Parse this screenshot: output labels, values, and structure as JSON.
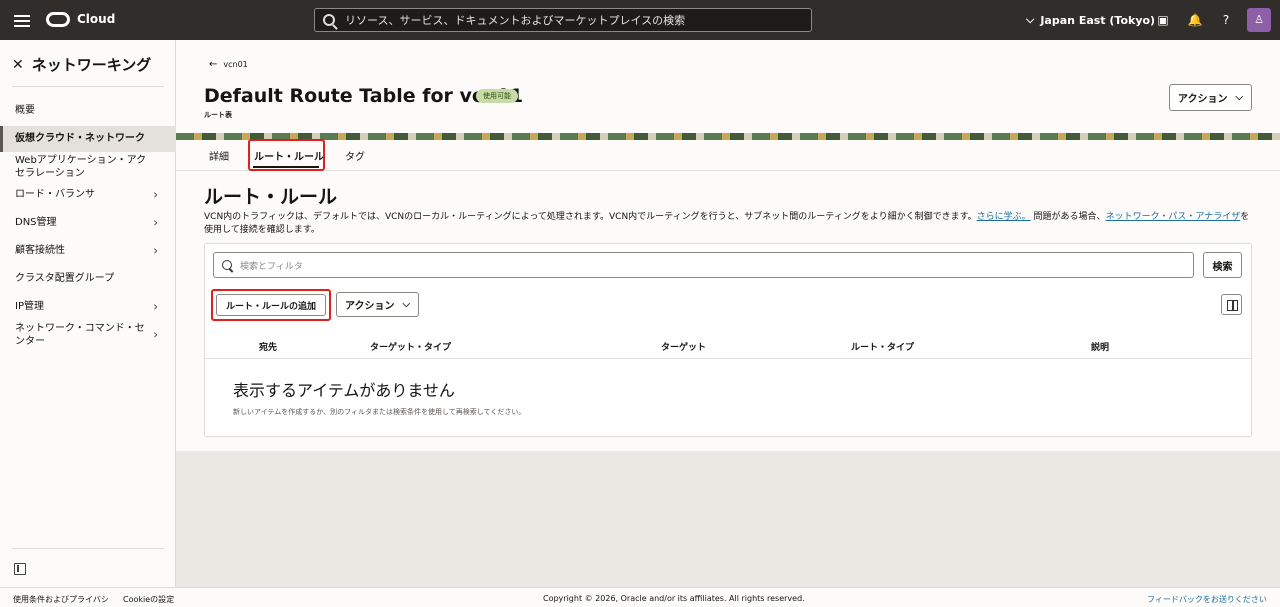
{
  "topbar": {
    "brand": "Cloud",
    "search_placeholder": "リソース、サービス、ドキュメントおよびマーケットプレイスの検索",
    "region": "Japan East (Tokyo)"
  },
  "sidebar": {
    "title": "ネットワーキング",
    "items": [
      {
        "label": "概要"
      },
      {
        "label": "仮想クラウド・ネットワーク"
      },
      {
        "label": "Webアプリケーション・アクセラレーション"
      },
      {
        "label": "ロード・バランサ"
      },
      {
        "label": "DNS管理"
      },
      {
        "label": "顧客接続性"
      },
      {
        "label": "クラスタ配置グループ"
      },
      {
        "label": "IP管理"
      },
      {
        "label": "ネットワーク・コマンド・センター"
      }
    ]
  },
  "header": {
    "back_label": "vcn01",
    "title": "Default Route Table for vcn01",
    "status_badge": "使用可能",
    "subtitle": "ルート表",
    "action_label": "アクション"
  },
  "tabs": [
    {
      "label": "詳細"
    },
    {
      "label": "ルート・ルール"
    },
    {
      "label": "タグ"
    }
  ],
  "section": {
    "title": "ルート・ルール",
    "desc_part1": "VCN内のトラフィックは、デフォルトでは、VCNのローカル・ルーティングによって処理されます。VCN内でルーティングを行うと、サブネット間のルーティングをより細かく制御できます。",
    "link1": "さらに学ぶ。",
    "desc_part2": " 問題がある場合、",
    "link2": "ネットワーク・パス・アナライザ",
    "desc_part3": "を使用して接続を確認します。"
  },
  "toolbar": {
    "filter_placeholder": "検索とフィルタ",
    "search_label": "検索",
    "add_label": "ルート・ルールの追加",
    "action_label": "アクション"
  },
  "table": {
    "columns": [
      "宛先",
      "ターゲット・タイプ",
      "ターゲット",
      "ルート・タイプ",
      "説明"
    ],
    "empty_title": "表示するアイテムがありません",
    "empty_desc": "新しいアイテムを作成するか、別のフィルタまたは検索条件を使用して再検索してください。"
  },
  "footer": {
    "terms": "使用条件およびプライバシ",
    "cookie": "Cookieの設定",
    "copyright": "Copyright © 2026, Oracle and/or its affiliates. All rights reserved.",
    "feedback": "フィードバックをお送りください"
  }
}
